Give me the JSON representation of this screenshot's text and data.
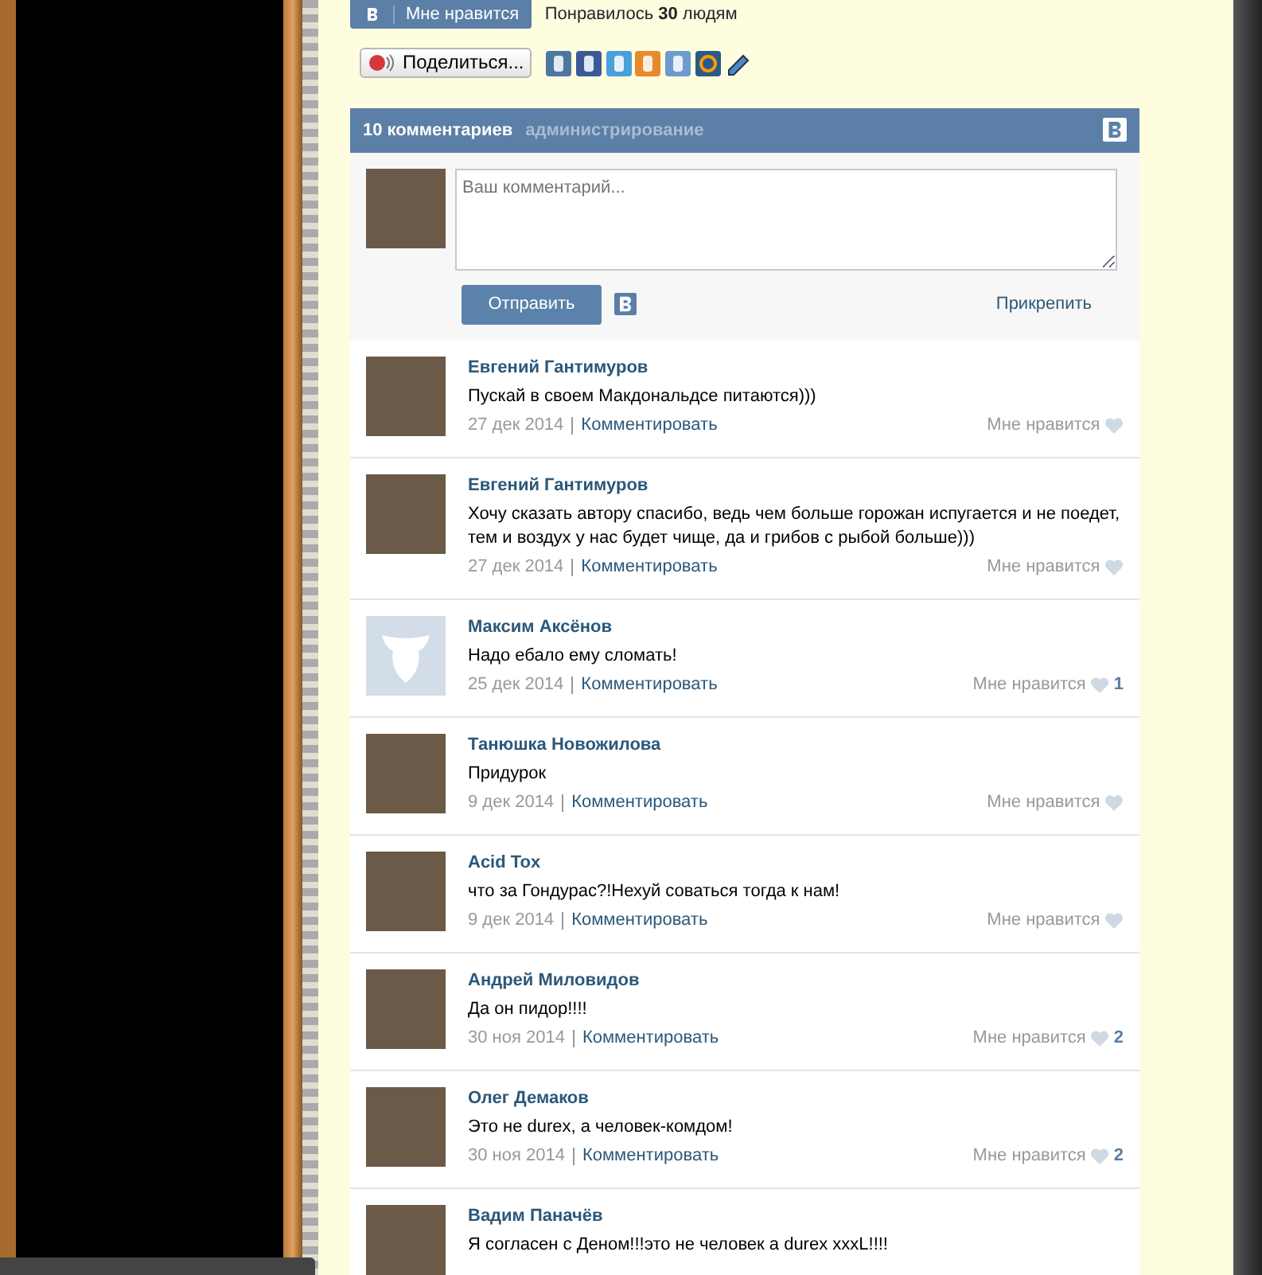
{
  "like_bar": {
    "button_label": "Мне нравится",
    "summary": "Понравилось **30** людям"
  },
  "share": {
    "button_label": "Поделиться..."
  },
  "comments_header": {
    "count": "10 комментариев",
    "admin_link": "администрирование"
  },
  "form": {
    "photo": true,
    "placeholder": "Ваш комментарий...",
    "submit": "Отправить",
    "attach": "Прикрепить"
  },
  "comments": [
    {
      "author": "Евгений Гантимуров",
      "photo": true,
      "text": "Пускай в своем Макдональдсе питаются)))",
      "date": "27 дек 2014",
      "reply": "Комментировать",
      "like_label": "Мне нравится"
    },
    {
      "author": "Евгений Гантимуров",
      "photo": true,
      "text": "Хочу сказать автору спасибо, ведь чем больше горожан испугается и не поедет, тем и воздух у нас будет чище, да и грибов с рыбой больше)))",
      "date": "27 дек 2014",
      "reply": "Комментировать",
      "like_label": "Мне нравится"
    },
    {
      "author": "Максим Аксёнов",
      "photo": false,
      "text": "Надо ебало ему сломать!",
      "date": "25 дек 2014",
      "reply": "Комментировать",
      "like_label": "Мне нравится",
      "likes": "1"
    },
    {
      "author": "Танюшка Новожилова",
      "photo": true,
      "text": "Придурок",
      "date": "9 дек 2014",
      "reply": "Комментировать",
      "like_label": "Мне нравится"
    },
    {
      "author": "Acid Tox",
      "photo": true,
      "text": "что за Гондурас?!Нехуй соваться тогда к нам!",
      "date": "9 дек 2014",
      "reply": "Комментировать",
      "like_label": "Мне нравится"
    },
    {
      "author": "Андрей Миловидов",
      "photo": true,
      "text": "Да он пидор!!!!",
      "date": "30 ноя 2014",
      "reply": "Комментировать",
      "like_label": "Мне нравится",
      "likes": "2"
    },
    {
      "author": "Олег Демаков",
      "photo": true,
      "text": "Это не durex, а человек-комдом!",
      "date": "30 ноя 2014",
      "reply": "Комментировать",
      "like_label": "Мне нравится",
      "likes": "2"
    },
    {
      "author": "Вадим Паначёв",
      "photo": true,
      "text": "Я согласен с Деном!!!это не человек а durex xxxL!!!!"
    }
  ]
}
